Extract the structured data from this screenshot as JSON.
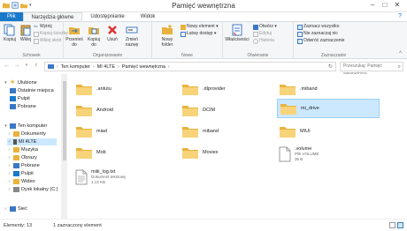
{
  "window": {
    "title": "Pamięć wewnętrzna"
  },
  "tabs": [
    "Plik",
    "Narzędzia główne",
    "Udostępnianie",
    "Widok"
  ],
  "ribbon": {
    "groups": {
      "clipboard": "Schowek",
      "organize": "Organizowanie",
      "new": "Nowe",
      "open": "Otwieranie",
      "select": "Zaznaczanie"
    },
    "buttons": {
      "copy": "Kopiuj",
      "paste": "Wklej",
      "cut": "Wytnij",
      "copy_path": "Kopiuj ścieżkę",
      "paste_shortcut": "Wklej skrót",
      "move_to": "Przenieś do",
      "copy_to": "Kopiuj do",
      "delete": "Usuń",
      "rename": "Zmień nazwę",
      "new_folder": "Nowy folder",
      "new_element": "Nowy element ▾",
      "easy_access": "Łatwy dostęp ▾",
      "properties": "Właściwości",
      "open": "Otwórz ▾",
      "edit": "Edytuj",
      "history": "Historia",
      "select_all": "Zaznacz wszystko",
      "select_none": "Nie zaznaczaj nic",
      "invert_selection": "Odwróć zaznaczenie"
    }
  },
  "address": {
    "crumbs": [
      "Ten komputer",
      "MI 4LTE",
      "Pamięć wewnętrzna"
    ],
    "search_placeholder": "Przeszukaj: Pamięć wewnętrzna"
  },
  "navpane": {
    "favorites": "Ulubione",
    "recent": "Ostatnie miejsca",
    "desktop": "Pulpit",
    "downloads": "Pobrane",
    "this_pc": "Ten komputer",
    "documents": "Dokumenty",
    "mi4lte": "MI 4LTE",
    "music": "Muzyka",
    "pictures": "Obrazy",
    "downloads2": "Pobrane",
    "desktop2": "Pulpit",
    "videos": "Wideo",
    "local_disk": "Dysk lokalny (C:)",
    "network": "Sieć"
  },
  "files": [
    {
      "name": ".antutu",
      "type": "folder"
    },
    {
      "name": ".dlprovider",
      "type": "folder"
    },
    {
      "name": ".miband",
      "type": "folder"
    },
    {
      "name": "Android",
      "type": "folder"
    },
    {
      "name": "DCIM",
      "type": "folder"
    },
    {
      "name": "mi_drive",
      "type": "folder",
      "selected": true
    },
    {
      "name": "miad",
      "type": "folder"
    },
    {
      "name": "miband",
      "type": "folder"
    },
    {
      "name": "MIUI",
      "type": "folder"
    },
    {
      "name": "Mob",
      "type": "folder"
    },
    {
      "name": "Movies",
      "type": "folder"
    },
    {
      "name": ".volume",
      "type": "file",
      "sub1": "Plik VOLUME",
      "sub2": "36 B"
    },
    {
      "name": "miiii_log.txt",
      "type": "file",
      "sub1": "Dokument tekstowy",
      "sub2": "1,13 KB"
    }
  ],
  "status": {
    "count": "Elementy: 13",
    "selected": "1 zaznaczony element"
  }
}
